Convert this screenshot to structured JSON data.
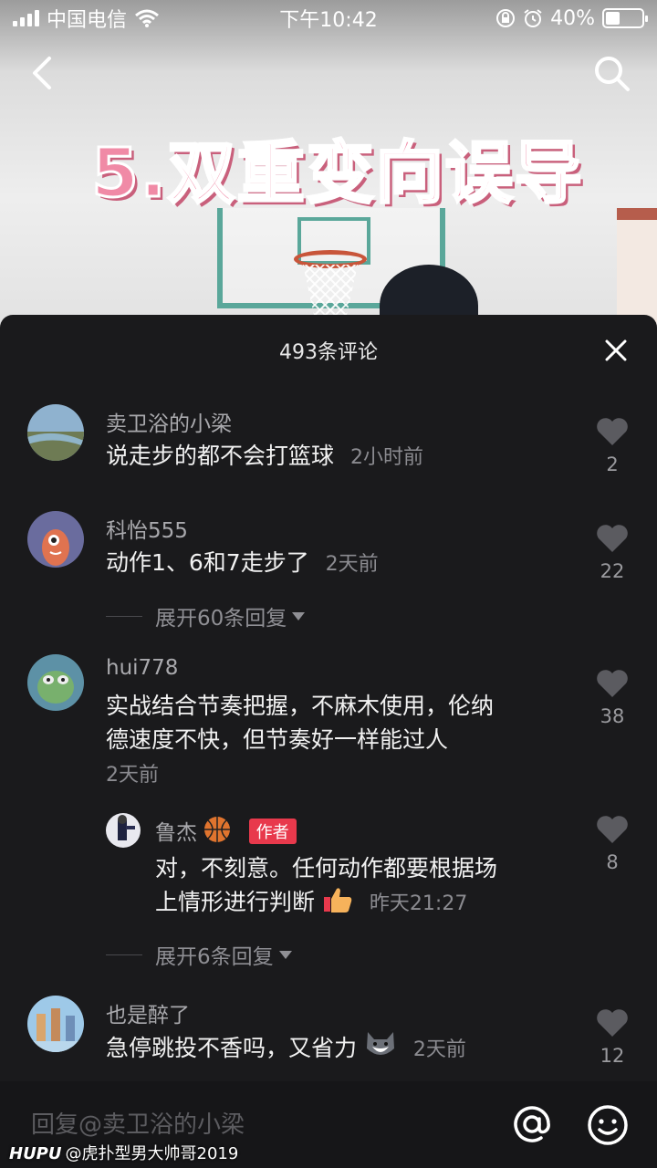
{
  "status": {
    "carrier": "中国电信",
    "time": "下午10:42",
    "battery_text": "40%",
    "battery_level": 0.4
  },
  "video": {
    "title": "5.双重变向误导"
  },
  "panel": {
    "title": "493条评论"
  },
  "comments": [
    {
      "name": "卖卫浴的小梁",
      "text": "说走步的都不会打篮球",
      "time": "2小时前",
      "likes": "2"
    },
    {
      "name": "科怡555",
      "text": "动作1、6和7走步了",
      "time": "2天前",
      "likes": "22",
      "expand": "展开60条回复"
    },
    {
      "name": "hui778",
      "text_line1": "实战结合节奏把握，不麻木使用，伦纳",
      "text_line2": "德速度不快，但节奏好一样能过人",
      "time": "2天前",
      "likes": "38",
      "reply": {
        "name": "鲁杰",
        "badge": "作者",
        "text_line1": "对，不刻意。任何动作都要根据场",
        "text_line2": "上情形进行判断",
        "time": "昨天21:27",
        "likes": "8"
      },
      "expand": "展开6条回复"
    },
    {
      "name": "也是醉了",
      "text": "急停跳投不香吗，又省力",
      "time": "2天前",
      "likes": "12"
    }
  ],
  "input": {
    "placeholder": "回复@卖卫浴的小梁"
  },
  "watermark": {
    "brand": "HUPU",
    "text": "@虎扑型男大帅哥2019"
  }
}
